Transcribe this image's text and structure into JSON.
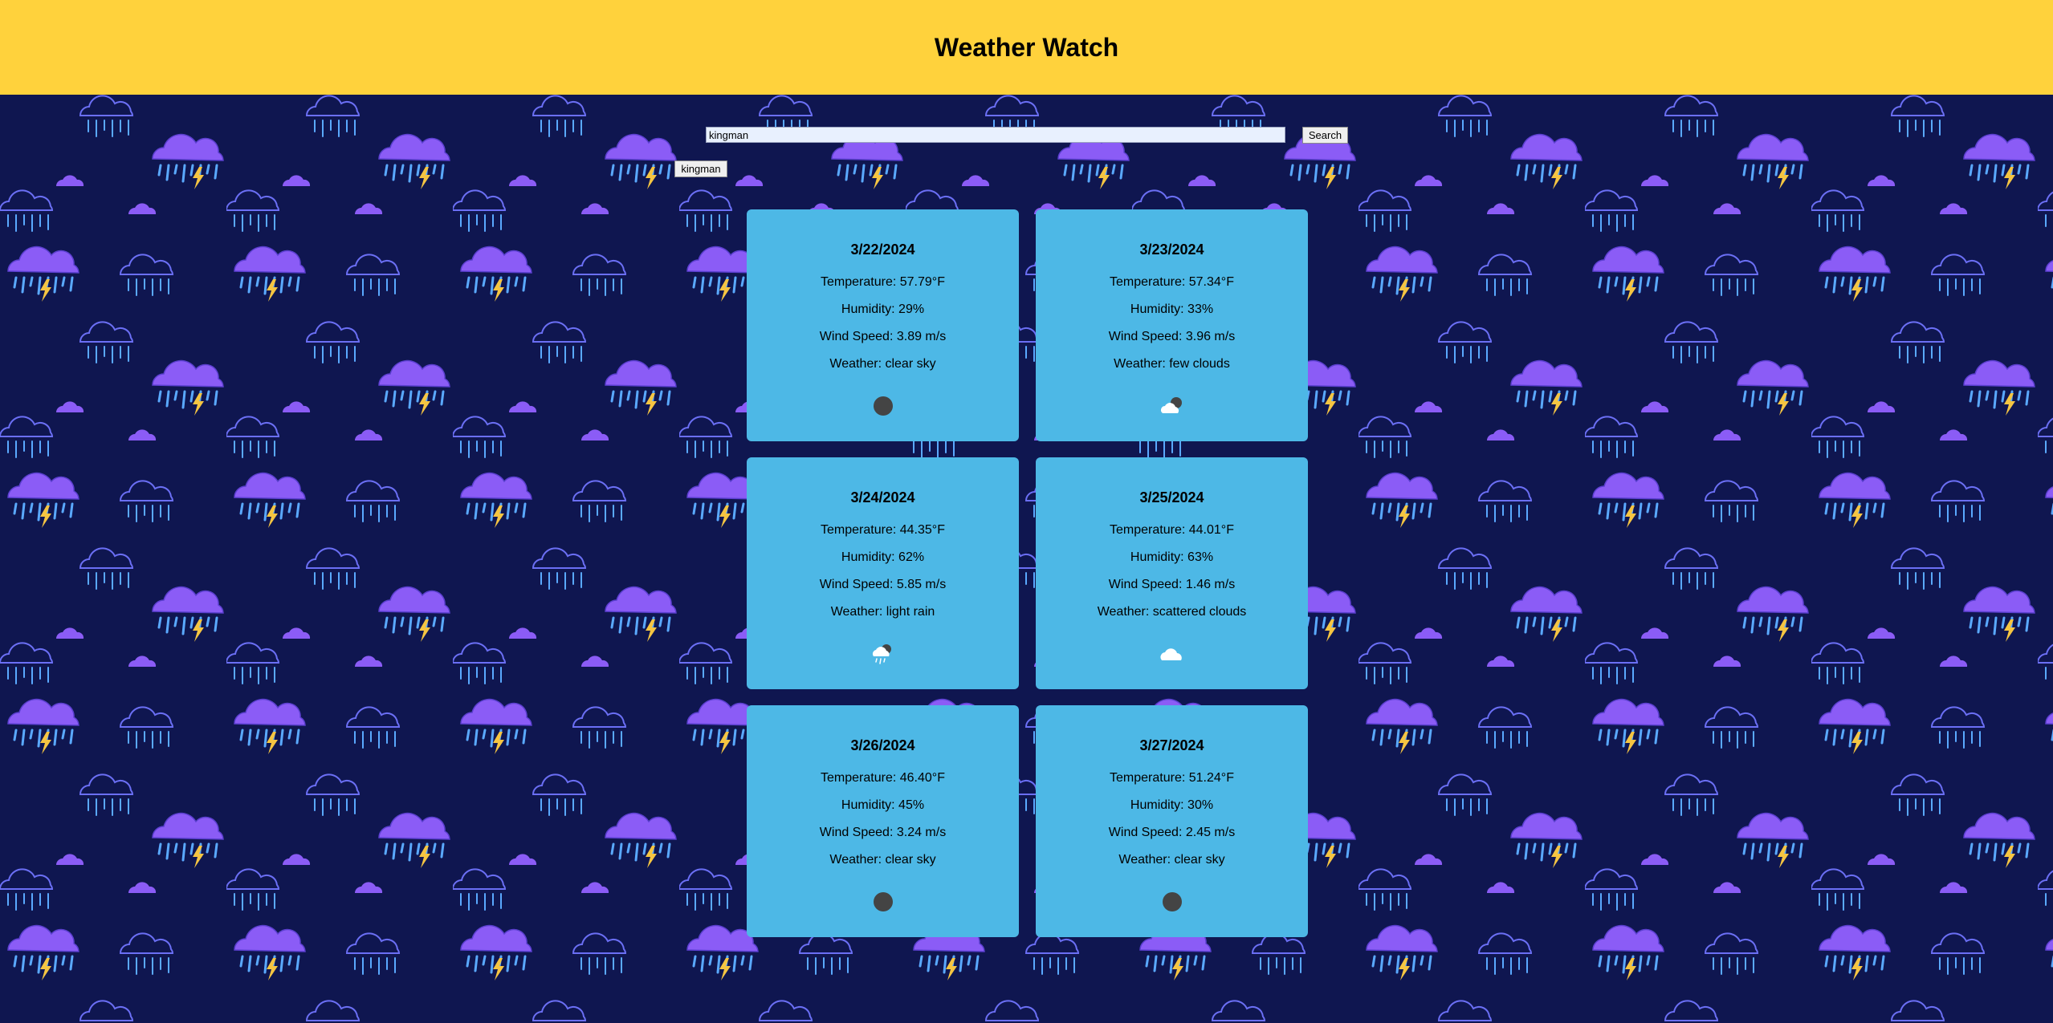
{
  "colors": {
    "header_bg": "#ffd23c",
    "page_bg": "#0f1650",
    "card_bg": "#4db8e6",
    "cloud_purple": "#8b5cf6",
    "cloud_outline": "#6b6ff5",
    "rain_blue": "#5aa9ff",
    "lightning": "#f5c542"
  },
  "header": {
    "title": "Weather Watch"
  },
  "search": {
    "value": "kingman",
    "button_label": "Search"
  },
  "history": [
    {
      "label": "kingman"
    }
  ],
  "labels": {
    "temperature": "Temperature: ",
    "humidity": "Humidity: ",
    "wind": "Wind Speed: ",
    "weather": "Weather: "
  },
  "forecast": [
    {
      "date": "3/22/2024",
      "temperature": "57.79°F",
      "humidity": "29%",
      "wind": "3.89 m/s",
      "weather": "clear sky",
      "icon": "clear-sky-icon"
    },
    {
      "date": "3/23/2024",
      "temperature": "57.34°F",
      "humidity": "33%",
      "wind": "3.96 m/s",
      "weather": "few clouds",
      "icon": "few-clouds-icon"
    },
    {
      "date": "3/24/2024",
      "temperature": "44.35°F",
      "humidity": "62%",
      "wind": "5.85 m/s",
      "weather": "light rain",
      "icon": "light-rain-icon"
    },
    {
      "date": "3/25/2024",
      "temperature": "44.01°F",
      "humidity": "63%",
      "wind": "1.46 m/s",
      "weather": "scattered clouds",
      "icon": "scattered-clouds-icon"
    },
    {
      "date": "3/26/2024",
      "temperature": "46.40°F",
      "humidity": "45%",
      "wind": "3.24 m/s",
      "weather": "clear sky",
      "icon": "clear-sky-icon"
    },
    {
      "date": "3/27/2024",
      "temperature": "51.24°F",
      "humidity": "30%",
      "wind": "2.45 m/s",
      "weather": "clear sky",
      "icon": "clear-sky-icon"
    }
  ]
}
